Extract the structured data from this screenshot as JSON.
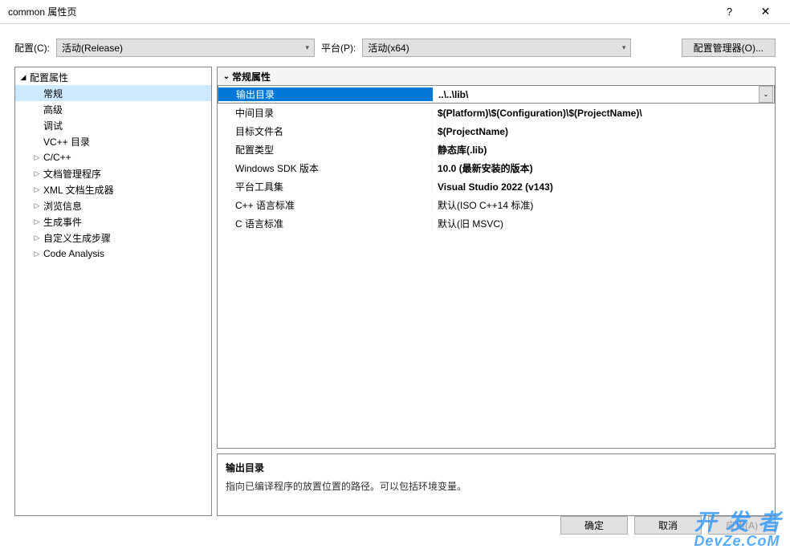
{
  "titlebar": {
    "title": "common 属性页",
    "help": "?",
    "close": "✕"
  },
  "config_row": {
    "config_label": "配置(C):",
    "config_value": "活动(Release)",
    "platform_label": "平台(P):",
    "platform_value": "活动(x64)",
    "manager_btn": "配置管理器(O)..."
  },
  "tree": {
    "root": "配置属性",
    "items": [
      {
        "label": "常规",
        "selected": true
      },
      {
        "label": "高级"
      },
      {
        "label": "调试"
      },
      {
        "label": "VC++ 目录"
      },
      {
        "label": "C/C++",
        "expandable": true
      },
      {
        "label": "文档管理程序",
        "expandable": true
      },
      {
        "label": "XML 文档生成器",
        "expandable": true
      },
      {
        "label": "浏览信息",
        "expandable": true
      },
      {
        "label": "生成事件",
        "expandable": true
      },
      {
        "label": "自定义生成步骤",
        "expandable": true
      },
      {
        "label": "Code Analysis",
        "expandable": true
      }
    ]
  },
  "props": {
    "group": "常规属性",
    "rows": [
      {
        "name": "输出目录",
        "value": "..\\..\\lib\\",
        "selected": true,
        "bold": true
      },
      {
        "name": "中间目录",
        "value": "$(Platform)\\$(Configuration)\\$(ProjectName)\\",
        "bold": true
      },
      {
        "name": "目标文件名",
        "value": "$(ProjectName)",
        "bold": true
      },
      {
        "name": "配置类型",
        "value": "静态库(.lib)",
        "bold": true
      },
      {
        "name": "Windows SDK 版本",
        "value": "10.0 (最新安装的版本)",
        "bold": true
      },
      {
        "name": "平台工具集",
        "value": "Visual Studio 2022 (v143)",
        "bold": true
      },
      {
        "name": "C++ 语言标准",
        "value": "默认(ISO C++14 标准)",
        "bold": false
      },
      {
        "name": "C 语言标准",
        "value": "默认(旧 MSVC)",
        "bold": false
      }
    ]
  },
  "description": {
    "title": "输出目录",
    "text": "指向已编译程序的放置位置的路径。可以包括环境变量。"
  },
  "buttons": {
    "ok": "确定",
    "cancel": "取消",
    "apply": "应用(A)"
  },
  "watermark": {
    "top": "开 发 者",
    "bottom": "DevZe.CoM"
  }
}
